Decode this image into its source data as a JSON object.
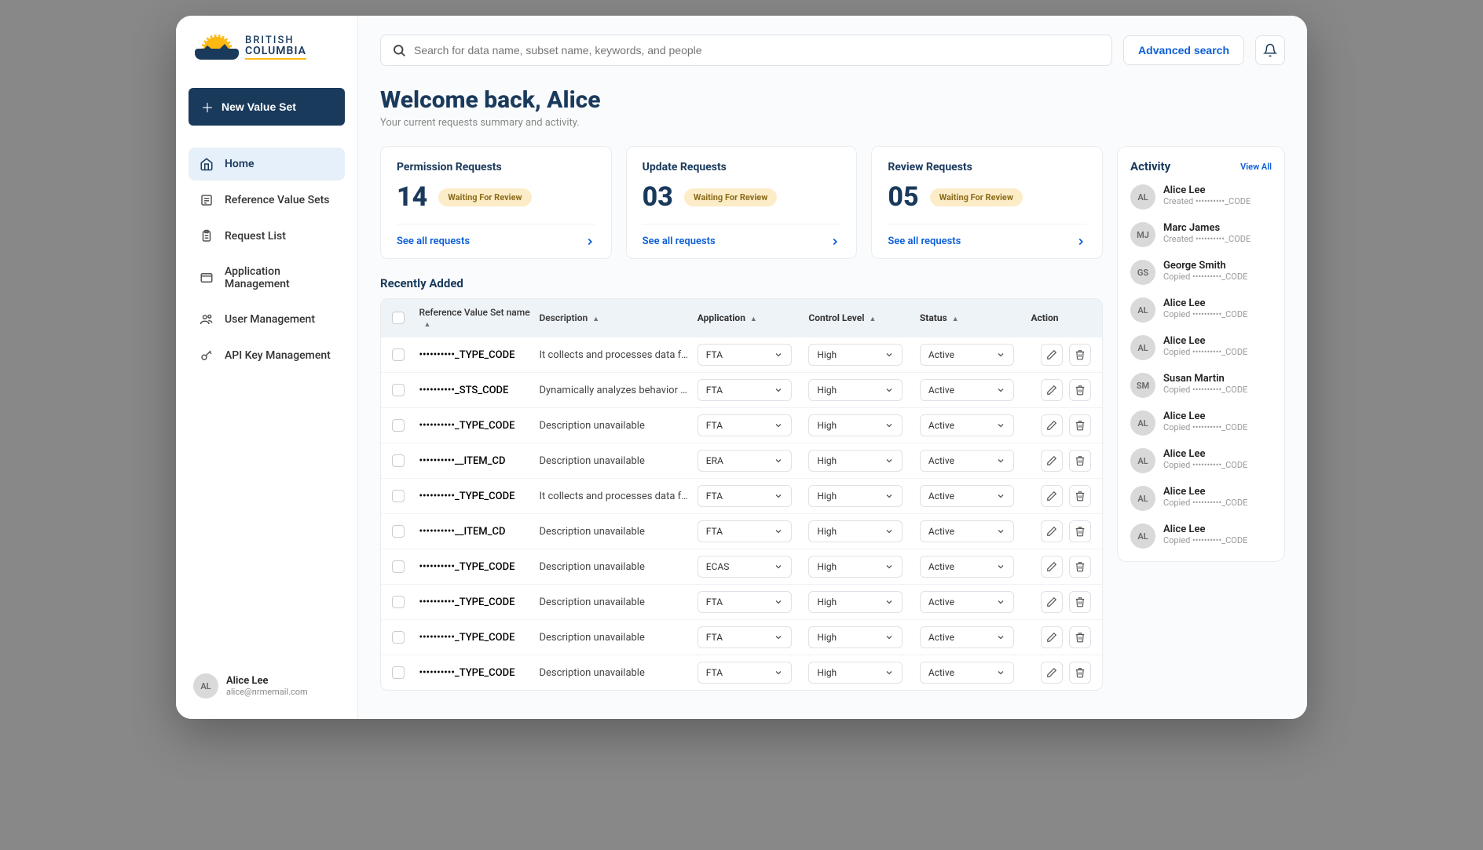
{
  "logo": {
    "line1": "BRITISH",
    "line2": "COLUMBIA"
  },
  "sidebar": {
    "new_btn": "New Value Set",
    "nav": [
      {
        "label": "Home",
        "icon": "home-icon",
        "active": true
      },
      {
        "label": "Reference Value Sets",
        "icon": "list-icon",
        "active": false
      },
      {
        "label": "Request List",
        "icon": "clipboard-icon",
        "active": false
      },
      {
        "label": "Application Management",
        "icon": "window-icon",
        "active": false
      },
      {
        "label": "User Management",
        "icon": "users-icon",
        "active": false
      },
      {
        "label": "API Key Management",
        "icon": "key-icon",
        "active": false
      }
    ],
    "user": {
      "name": "Alice Lee",
      "email": "alice@nrmemail.com",
      "initials": "AL"
    }
  },
  "topbar": {
    "search_placeholder": "Search for data name, subset name, keywords, and people",
    "advanced": "Advanced search"
  },
  "welcome": {
    "title": "Welcome back, Alice",
    "subtitle": "Your current requests summary and activity."
  },
  "request_cards": [
    {
      "title": "Permission Requests",
      "count": "14",
      "badge": "Waiting For Review",
      "link": "See all requests"
    },
    {
      "title": "Update Requests",
      "count": "03",
      "badge": "Waiting For Review",
      "link": "See all requests"
    },
    {
      "title": "Review Requests",
      "count": "05",
      "badge": "Waiting For Review",
      "link": "See all requests"
    }
  ],
  "recent": {
    "title": "Recently Added",
    "columns": {
      "name": "Reference Value Set name",
      "desc": "Description",
      "app": "Application",
      "ctrl": "Control Level",
      "status": "Status",
      "action": "Action"
    },
    "rows": [
      {
        "name": "••••••••••_TYPE_CODE",
        "desc": "It collects and processes data from ...",
        "app": "FTA",
        "ctrl": "High",
        "status": "Active"
      },
      {
        "name": "••••••••••_STS_CODE",
        "desc": "Dynamically analyzes behavior and...",
        "app": "FTA",
        "ctrl": "High",
        "status": "Active"
      },
      {
        "name": "••••••••••_TYPE_CODE",
        "desc": "Description unavailable",
        "app": "FTA",
        "ctrl": "High",
        "status": "Active"
      },
      {
        "name": "••••••••••__ITEM_CD",
        "desc": "Description unavailable",
        "app": "ERA",
        "ctrl": "High",
        "status": "Active"
      },
      {
        "name": "••••••••••_TYPE_CODE",
        "desc": "It collects and processes data from ...",
        "app": "FTA",
        "ctrl": "High",
        "status": "Active"
      },
      {
        "name": "••••••••••__ITEM_CD",
        "desc": "Description unavailable",
        "app": "FTA",
        "ctrl": "High",
        "status": "Active"
      },
      {
        "name": "••••••••••_TYPE_CODE",
        "desc": "Description unavailable",
        "app": "ECAS",
        "ctrl": "High",
        "status": "Active"
      },
      {
        "name": "••••••••••_TYPE_CODE",
        "desc": "Description unavailable",
        "app": "FTA",
        "ctrl": "High",
        "status": "Active"
      },
      {
        "name": "••••••••••_TYPE_CODE",
        "desc": "Description unavailable",
        "app": "FTA",
        "ctrl": "High",
        "status": "Active"
      },
      {
        "name": "••••••••••_TYPE_CODE",
        "desc": "Description unavailable",
        "app": "FTA",
        "ctrl": "High",
        "status": "Active"
      }
    ]
  },
  "activity": {
    "title": "Activity",
    "view_all": "View All",
    "items": [
      {
        "initials": "AL",
        "name": "Alice Lee",
        "sub": "Created  ••••••••••_CODE"
      },
      {
        "initials": "MJ",
        "name": "Marc James",
        "sub": "Created  ••••••••••_CODE"
      },
      {
        "initials": "GS",
        "name": "George Smith",
        "sub": "Copied  ••••••••••_CODE"
      },
      {
        "initials": "AL",
        "name": "Alice Lee",
        "sub": "Copied  ••••••••••_CODE"
      },
      {
        "initials": "AL",
        "name": "Alice Lee",
        "sub": "Copied  ••••••••••_CODE"
      },
      {
        "initials": "SM",
        "name": "Susan Martin",
        "sub": "Copied  ••••••••••_CODE"
      },
      {
        "initials": "AL",
        "name": "Alice Lee",
        "sub": "Copied  ••••••••••_CODE"
      },
      {
        "initials": "AL",
        "name": "Alice Lee",
        "sub": "Copied  ••••••••••_CODE"
      },
      {
        "initials": "AL",
        "name": "Alice Lee",
        "sub": "Copied  ••••••••••_CODE"
      },
      {
        "initials": "AL",
        "name": "Alice Lee",
        "sub": "Copied  ••••••••••_CODE"
      }
    ]
  }
}
